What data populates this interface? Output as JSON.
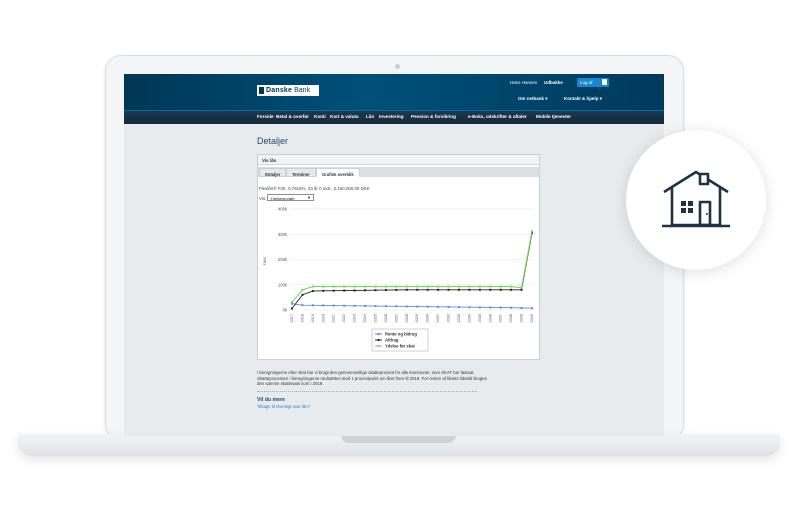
{
  "header": {
    "logo_word1": "Danske",
    "logo_word2": "Bank",
    "user_name": "Hans Hansen",
    "logout_link": "Udbakke",
    "login_button": "Log af",
    "menu_about": "Om netbank ▾",
    "menu_contact": "Kontakt & hjælp ▾"
  },
  "nav": [
    "Forside",
    "Betal & overfør",
    "Konti",
    "Kort & valuta",
    "Lån",
    "Investering",
    "Pension & forsikring",
    "e-Boks, udskrifter & aftaler",
    "Mobile tjenester"
  ],
  "page_title": "Detaljer",
  "panel": {
    "heading": "Vis lån",
    "tabs": [
      "Detaljer",
      "Terminer",
      "Grafisk overblik"
    ],
    "active_tab": 2,
    "info_text": "Flexlån® F3K, 0,7516%, 23 år 0 mdr., 2.160.000,00 DKK",
    "select_label": "Vis:",
    "select_value": "Ydelsesforløb"
  },
  "chart_data": {
    "type": "line",
    "ylabel": "DKK",
    "yticks": [
      "400k",
      "300k",
      "200k",
      "100k",
      "0k"
    ],
    "ylim": [
      0,
      400000
    ],
    "x": [
      "2017",
      "2018",
      "2019",
      "2020",
      "2021",
      "2022",
      "2023",
      "2024",
      "2025",
      "2026",
      "2027",
      "2028",
      "2029",
      "2030",
      "2031",
      "2032",
      "2033",
      "2034",
      "2035",
      "2036",
      "2037",
      "2038",
      "2039",
      "2040"
    ],
    "series": [
      {
        "name": "Rente og bidrag",
        "color": "#5b8fd6",
        "values": [
          25000,
          19000,
          18500,
          18000,
          17500,
          17000,
          16500,
          16000,
          15500,
          15000,
          14500,
          14000,
          13500,
          13000,
          12500,
          12000,
          11500,
          11000,
          10500,
          10000,
          9500,
          9000,
          8000,
          7000
        ]
      },
      {
        "name": "Afdrag",
        "color": "#222222",
        "values": [
          6000,
          60000,
          75000,
          76000,
          76500,
          77000,
          77500,
          78000,
          78500,
          79000,
          79500,
          80000,
          80000,
          80000,
          80000,
          80000,
          80000,
          80000,
          80000,
          80000,
          80000,
          80000,
          80000,
          305000
        ]
      },
      {
        "name": "Ydelse før skat",
        "color": "#7cd35a",
        "values": [
          31000,
          80000,
          93000,
          93000,
          93000,
          93000,
          93000,
          93000,
          93000,
          93000,
          93000,
          93000,
          93000,
          93000,
          93000,
          93000,
          93000,
          93000,
          93000,
          93000,
          93000,
          93000,
          88000,
          312000
        ]
      }
    ],
    "legend_position": "bottom"
  },
  "footnote": "I beregningerne efter skat har vi brugt den gennemsnitlige skatteprocent for alle kommuner, som SKAT har fastsat. Skatteprocenten i beregningerne nedsættes med 1 procentpoint om året frem til 2019. For resten af lånets löbetid bruges den samme skattesats som i 2019.",
  "vil_du_mere": "Vil du mere",
  "back_link": "Tilbage til Oversigt over lån?"
}
